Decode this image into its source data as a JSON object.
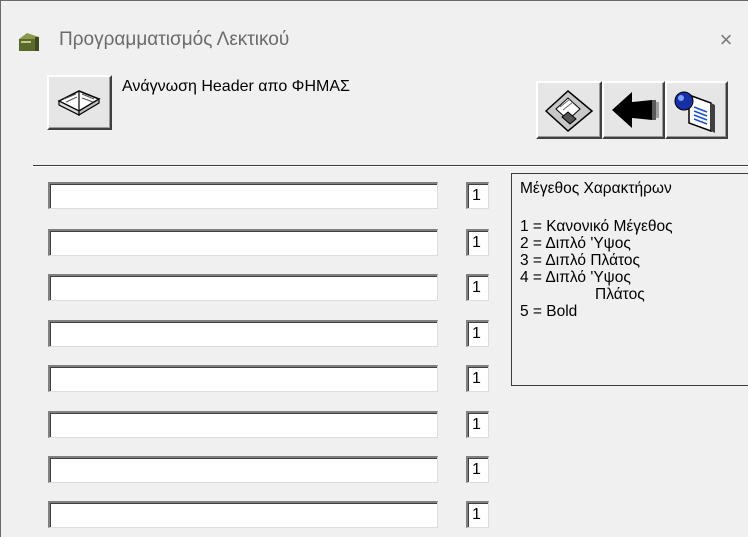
{
  "window": {
    "title": "Προγραμματισμός Λεκτικού",
    "close_symbol": "×"
  },
  "toolbar": {
    "read_header_label": "Ανάγνωση Header απο  ΦΗΜΑΣ",
    "read_button_icon": "open-book-icon",
    "save_button_icon": "floppy-disk-icon",
    "back_button_icon": "arrow-left-icon",
    "exit_button_icon": "document-globe-icon"
  },
  "rows": [
    {
      "text": "",
      "size": "1"
    },
    {
      "text": "",
      "size": "1"
    },
    {
      "text": "",
      "size": "1"
    },
    {
      "text": "",
      "size": "1"
    },
    {
      "text": "",
      "size": "1"
    },
    {
      "text": "",
      "size": "1"
    },
    {
      "text": "",
      "size": "1"
    },
    {
      "text": "",
      "size": "1"
    }
  ],
  "legend": {
    "title": "Μέγεθος Χαρακτήρων",
    "items": [
      "1 = Κανονικό Μέγεθος",
      "2 = Διπλό 'Υψος",
      "3 = Διπλό Πλάτος",
      "4 = Διπλό 'Υψος",
      "Πλάτος",
      "5 = Bold"
    ]
  },
  "colors": {
    "window_bg": "#f0f0f0",
    "title_text": "#6b6b6b",
    "field_bg": "#ffffff"
  }
}
